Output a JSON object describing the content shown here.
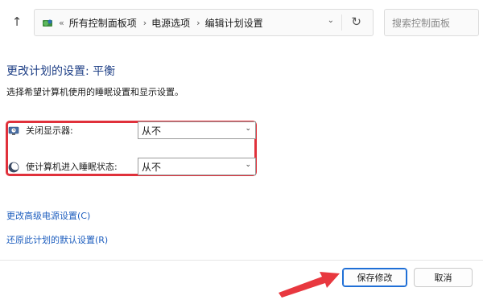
{
  "address_bar": {
    "breadcrumbs": [
      "所有控制面板项",
      "电源选项",
      "编辑计划设置"
    ],
    "overflow_chevron": "«",
    "separator": "›",
    "icons": [
      "control-panel-icon",
      "chevron-down-icon",
      "refresh-icon"
    ]
  },
  "search": {
    "placeholder": "搜索控制面板"
  },
  "main": {
    "title": "更改计划的设置: 平衡",
    "description": "选择希望计算机使用的睡眠设置和显示设置。",
    "settings": [
      {
        "label": "关闭显示器:",
        "value": "从不",
        "icon": "monitor-clock-icon"
      },
      {
        "label": "使计算机进入睡眠状态:",
        "value": "从不",
        "icon": "moon-icon"
      }
    ],
    "links": {
      "advanced": "更改高级电源设置(C)",
      "restore": "还原此计划的默认设置(R)"
    }
  },
  "footer": {
    "save_label": "保存修改",
    "cancel_label": "取消"
  },
  "annotations": {
    "highlight_color": "#e0313b",
    "arrow_color": "#e8383f"
  }
}
